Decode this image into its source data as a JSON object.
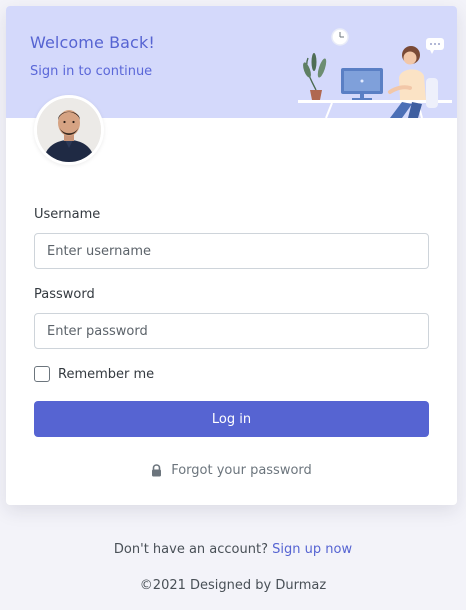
{
  "header": {
    "title": "Welcome Back!",
    "subtitle": "Sign in to continue"
  },
  "form": {
    "username_label": "Username",
    "username_placeholder": "Enter username",
    "username_value": "",
    "password_label": "Password",
    "password_placeholder": "Enter password",
    "password_value": "",
    "remember_label": "Remember me",
    "remember_checked": false,
    "login_label": "Log in",
    "forgot_label": "Forgot your password"
  },
  "footer": {
    "signup_prompt": "Don't have an account?",
    "signup_link": "Sign up now",
    "copyright": "©2021 Designed by Durmaz"
  },
  "icons": {
    "forgot": "lock-icon",
    "avatar": "user-avatar",
    "illustration": "desk-illustration"
  },
  "colors": {
    "accent": "#5664d2",
    "header_bg": "#d4d9fb",
    "page_bg": "#f3f3f9"
  }
}
